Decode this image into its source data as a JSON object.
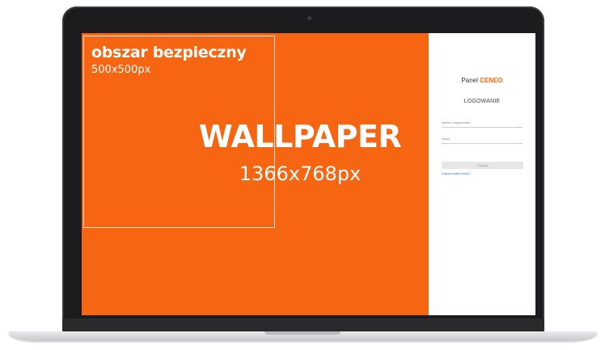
{
  "wallpaper": {
    "safe_area_title": "obszar bezpieczny",
    "safe_area_size": "500x500px",
    "title": "WALLPAPER",
    "size": "1366x768px",
    "color": "#f66512"
  },
  "login_panel": {
    "title_prefix": "Panel ",
    "title_brand": "CENEO",
    "heading": "LOGOWANIE",
    "username_label": "Nazwa użytkownika",
    "password_label": "Hasło",
    "login_button": "Zaloguj",
    "forgot_link": "Zapomniałeś hasła?",
    "link_color": "#2b7bd6"
  },
  "device": {
    "type": "laptop",
    "camera_icon": "camera-dot-icon"
  }
}
